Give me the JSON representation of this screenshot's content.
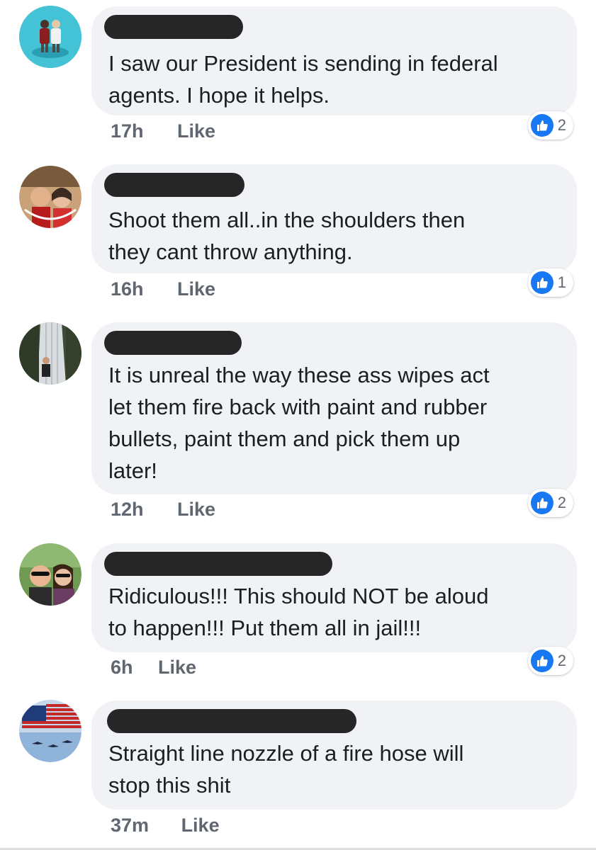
{
  "comments": [
    {
      "text": "I saw our President is sending in federal\nagents. I hope it helps.",
      "time": "17h",
      "like_label": "Like",
      "reaction_count": "2",
      "avatar_icon": "avatar-figurines"
    },
    {
      "text": "Shoot them all..in the shoulders then\nthey cant throw anything.",
      "time": "16h",
      "like_label": "Like",
      "reaction_count": "1",
      "avatar_icon": "avatar-couple-photo"
    },
    {
      "text": "It is unreal the way these ass wipes act\nlet them fire back with paint and rubber\nbullets, paint them and pick them up\nlater!",
      "time": "12h",
      "like_label": "Like",
      "reaction_count": "2",
      "avatar_icon": "avatar-waterfall"
    },
    {
      "text": "Ridiculous!!! This should NOT be aloud\nto happen!!! Put them all in jail!!!",
      "time": "6h",
      "like_label": "Like",
      "reaction_count": "2",
      "avatar_icon": "avatar-couple-sunglasses"
    },
    {
      "text": "Straight line nozzle of a fire hose will\nstop this shit",
      "time": "37m",
      "like_label": "Like",
      "avatar_icon": "avatar-flag-jets"
    }
  ],
  "colors": {
    "bubble": "#f0f2f5",
    "meta": "#606770",
    "like_blue": "#1877f2",
    "redaction": "#262626"
  }
}
